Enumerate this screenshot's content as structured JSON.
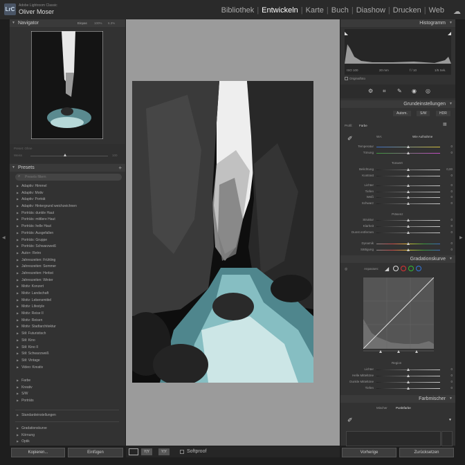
{
  "app": {
    "logo": "LrC",
    "name": "Adobe Lightroom Classic",
    "user": "Oliver Moser"
  },
  "modules": [
    "Bibliothek",
    "Entwickeln",
    "Karte",
    "Buch",
    "Diashow",
    "Drucken",
    "Web"
  ],
  "active_module": "Entwickeln",
  "navigator": {
    "title": "Navigator",
    "zoom_fit": "Einpas",
    "zoom_100": "100%",
    "zoom_other": "6.3%"
  },
  "history": {
    "label": "Preset: Ohne",
    "left": "Weiss",
    "right": "100"
  },
  "presets": {
    "title": "Presets",
    "search_placeholder": "Presets filtern",
    "items": [
      "Adaptiv: Himmel",
      "Adaptiv: Motiv",
      "Adaptiv: Porträt",
      "Adaptiv: Hintergrund weichzeichnen",
      "Porträts: dunkle Haut",
      "Porträts: mittlere Haut",
      "Porträts: helle Haut",
      "Porträts: Ausgefallen",
      "Porträts: Gruppe",
      "Porträts: Schwarzweiß",
      "Auto+: Retro",
      "Jahreszeiten: Frühling",
      "Jahreszeiten: Sommer",
      "Jahreszeiten: Herbst",
      "Jahreszeiten: Winter",
      "Motiv: Konzert",
      "Motiv: Landschaft",
      "Motiv: Lebensmittel",
      "Motiv: Lifestyle",
      "Motiv: Reise II",
      "Motiv: Reisen",
      "Motiv: Stadtarchitektur",
      "Stil: Futuristisch",
      "Stil: Kino",
      "Stil: Kino II",
      "Stil: Schwarzweiß",
      "Stil: Vintage",
      "Video: Kreativ"
    ],
    "groups": [
      "Farbe",
      "Kreativ",
      "S/W",
      "Porträts"
    ],
    "standard": "Standardeinstellungen",
    "extra": [
      "Gradationskurve",
      "Körnung",
      "Optik"
    ]
  },
  "left_buttons": {
    "copy": "Kopieren...",
    "paste": "Einfügen"
  },
  "toolbar": {
    "softproof": "Softproof"
  },
  "histogram": {
    "title": "Histogramm",
    "iso": "ISO 100",
    "focal": "20 mm",
    "aperture": "f / 10",
    "shutter": "1/5 Sek.",
    "original": "Originalfoto"
  },
  "basic": {
    "title": "Grundeinstellungen",
    "modes": [
      "Autom.",
      "S/W",
      "HDR"
    ],
    "profile_label": "Profil:",
    "profile_value": "Farbe",
    "wb_label": "WA:",
    "wb_value": "Wie Aufnahme",
    "temp": {
      "label": "Temperatur",
      "value": "0"
    },
    "tint": {
      "label": "Tönung",
      "value": "0"
    },
    "tone_title": "Tonwert",
    "exposure": {
      "label": "Belichtung",
      "value": "0,00"
    },
    "contrast": {
      "label": "Kontrast",
      "value": "0"
    },
    "highlights": {
      "label": "Lichter",
      "value": "0"
    },
    "shadows": {
      "label": "Tiefen",
      "value": "0"
    },
    "whites": {
      "label": "Weiß",
      "value": "0"
    },
    "blacks": {
      "label": "Schwarz",
      "value": "0"
    },
    "presence_title": "Präsenz",
    "texture": {
      "label": "Struktur",
      "value": "0"
    },
    "clarity": {
      "label": "Klarheit",
      "value": "0"
    },
    "dehaze": {
      "label": "Dunst entfernen",
      "value": "0"
    },
    "vibrance": {
      "label": "Dynamik",
      "value": "0"
    },
    "saturation": {
      "label": "Sättigung",
      "value": "0"
    }
  },
  "curve": {
    "title": "Gradationskurve",
    "adjust_label": "Anpassen:",
    "region_title": "Region",
    "highlights": "Lichter",
    "lights": "Helle Mitteltöne",
    "darks": "Dunkle Mitteltöne",
    "shadows": "Tiefen",
    "values": [
      "0",
      "0",
      "0",
      "0"
    ]
  },
  "mixer": {
    "title": "Farbmischer",
    "tab_mixer": "Mischer",
    "tab_point": "Punktfarbe"
  },
  "right_buttons": {
    "previous": "Vorherige",
    "reset": "Zurücksetzen"
  }
}
